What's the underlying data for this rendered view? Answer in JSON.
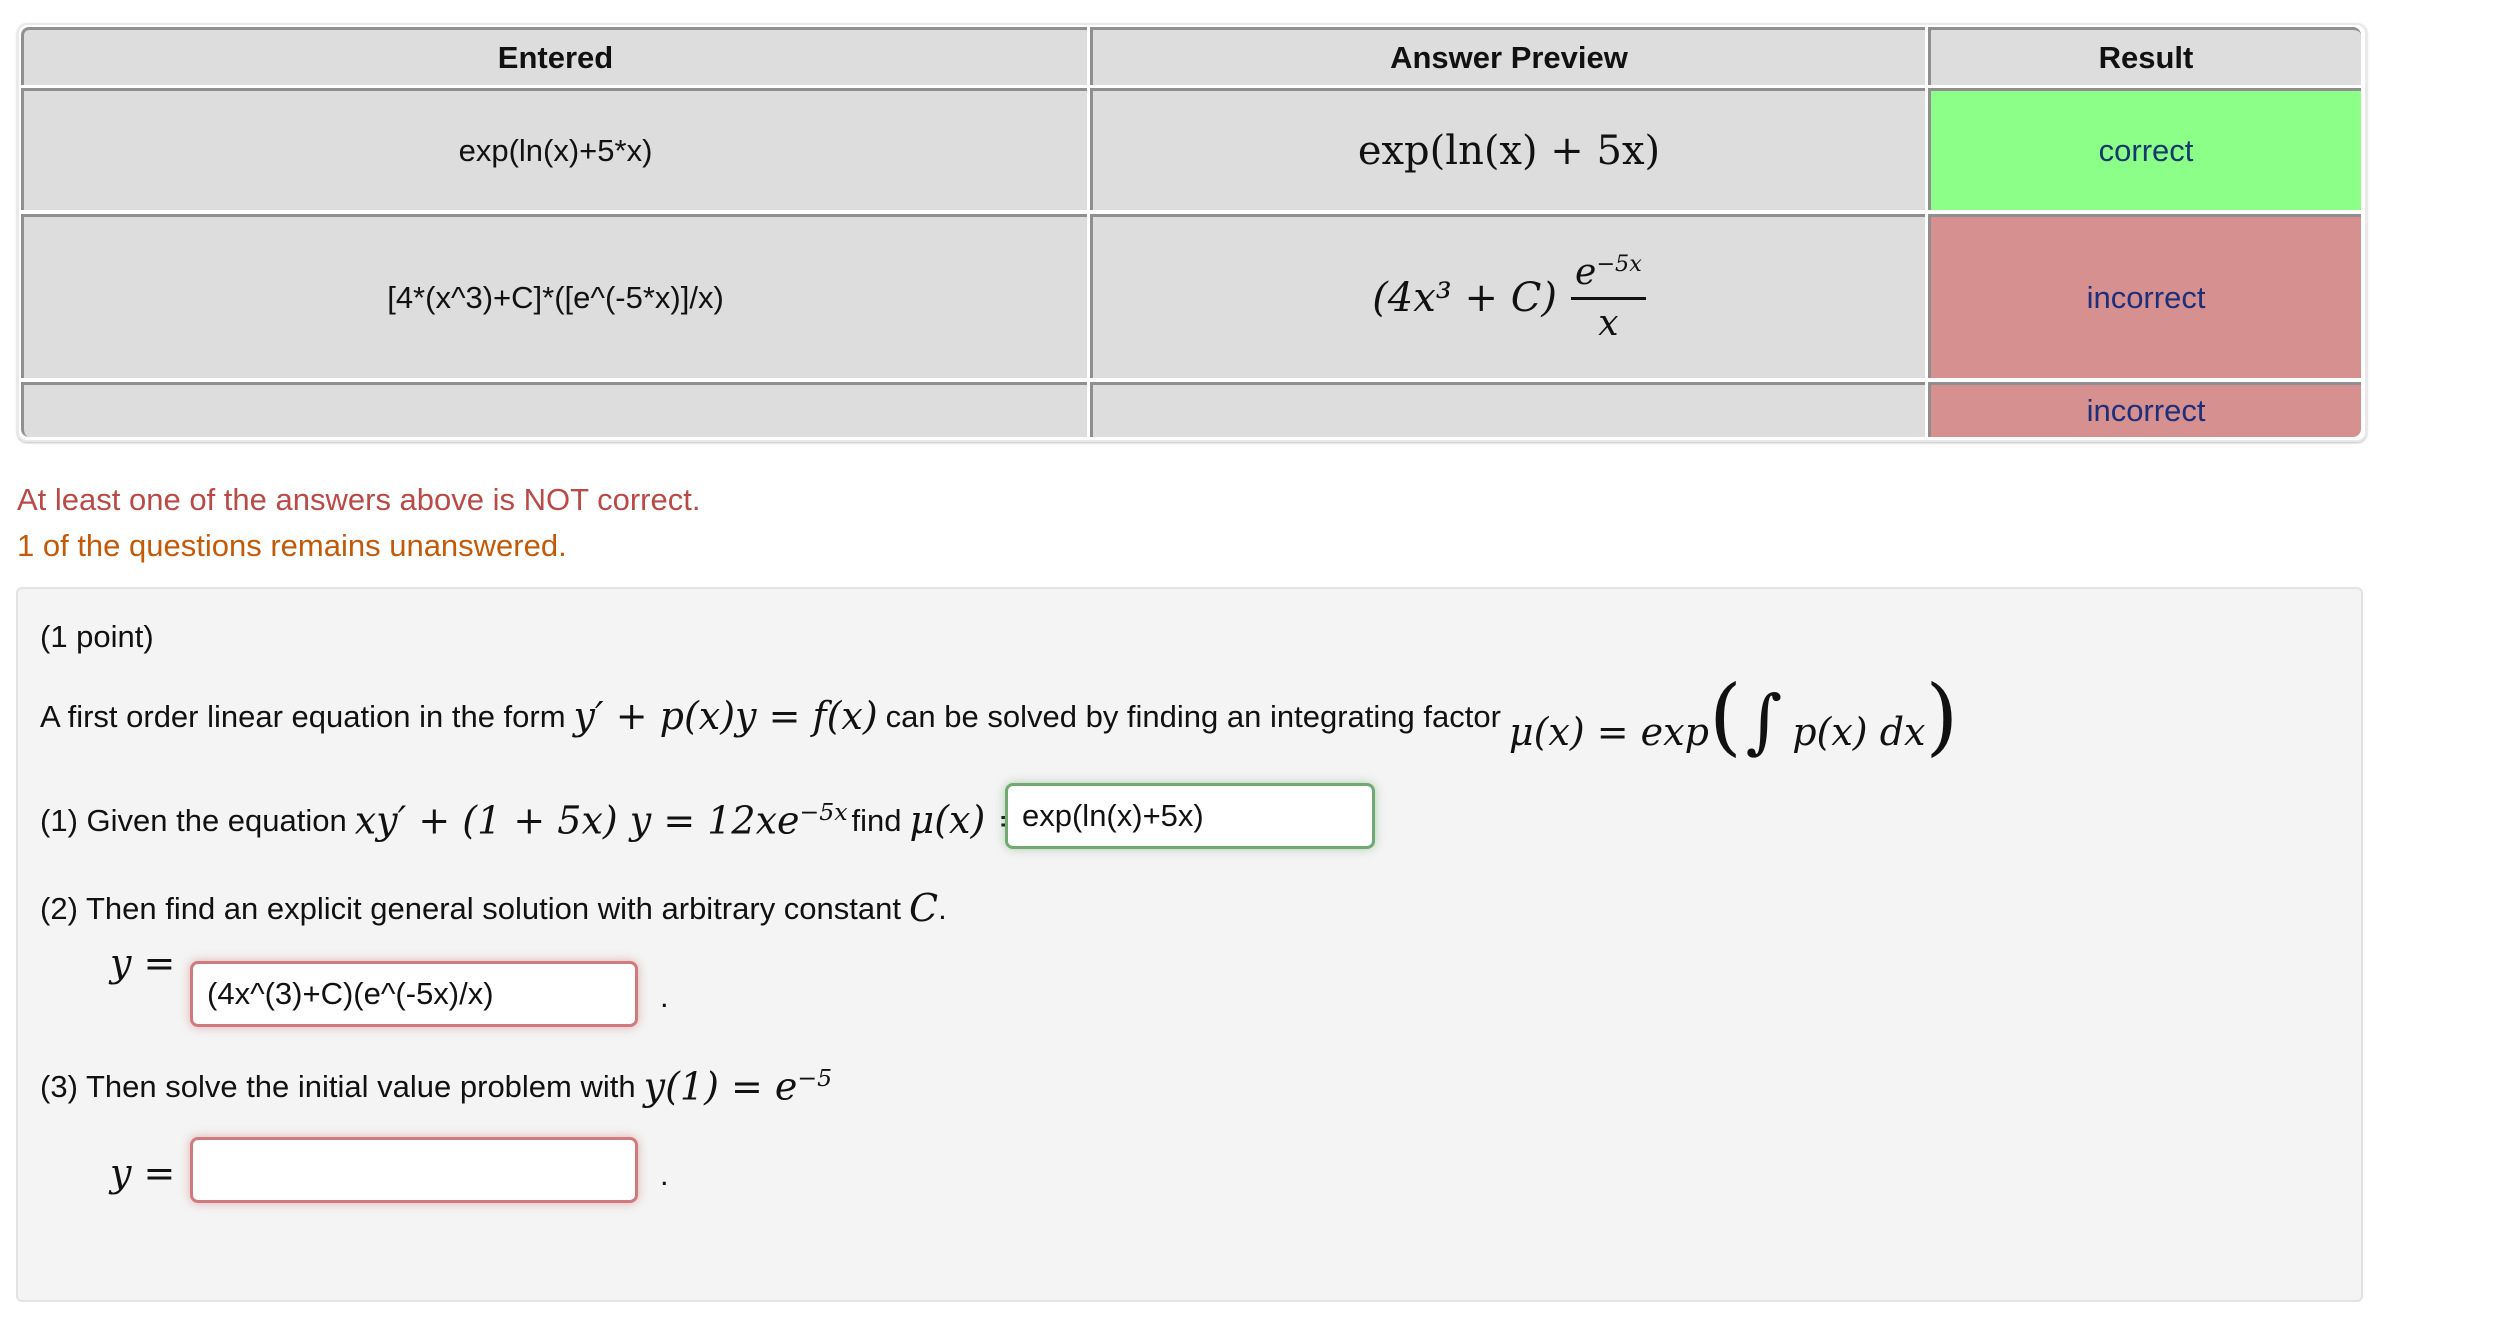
{
  "results_table": {
    "headers": [
      "Entered",
      "Answer Preview",
      "Result"
    ],
    "rows": [
      {
        "entered": "exp(ln(x)+5*x)",
        "preview": {
          "text": "exp(ln(x) + 5x)"
        },
        "result": "correct",
        "status": "correct"
      },
      {
        "entered": "[4*(x^3)+C]*([e^(-5*x)]/x)",
        "preview": {
          "factor": "(4x³ + C)",
          "numerator_base": "e",
          "numerator_exp": "−5x",
          "denominator": "x"
        },
        "result": "incorrect",
        "status": "incorrect"
      },
      {
        "entered": "",
        "preview": {
          "text": ""
        },
        "result": "incorrect",
        "status": "incorrect"
      }
    ],
    "colors": {
      "correct_bg": "#8cff88",
      "incorrect_bg": "#d69090",
      "header_bg": "#dddddd"
    }
  },
  "messages": {
    "error": "At least one of the answers above is NOT correct.",
    "warning": "1 of the questions remains unanswered.",
    "error_color": "#b94a48",
    "warning_color": "#c35a0a"
  },
  "problem": {
    "points": "(1 point)",
    "intro_prefix": "A first order linear equation in the form",
    "intro_eq": "y′ + p(x)y = f(x)",
    "intro_mid": "can be solved by finding an integrating factor",
    "intro_mu": "μ(x) = exp",
    "intro_integrand": "p(x) dx",
    "part1_prefix": "(1) Given the equation",
    "part1_eq": "xy′ + (1 + 5x) y = 12xe",
    "part1_eq_exp": "−5x",
    "part1_find": "find",
    "part1_mu": "μ(x) =",
    "part1_answer": "exp(ln(x)+5x)",
    "part2_text": "(2) Then find an explicit general solution with arbitrary constant",
    "part2_const": "C",
    "part2_period": ".",
    "part2_label": "y =",
    "part2_answer": "(4x^(3)+C)(e^(-5x)/x)",
    "part3_prefix": "(3) Then solve the initial value problem with",
    "part3_eq": "y(1) = e",
    "part3_eq_exp": "−5",
    "part3_label": "y =",
    "part3_answer": "",
    "trailing_period": "."
  }
}
